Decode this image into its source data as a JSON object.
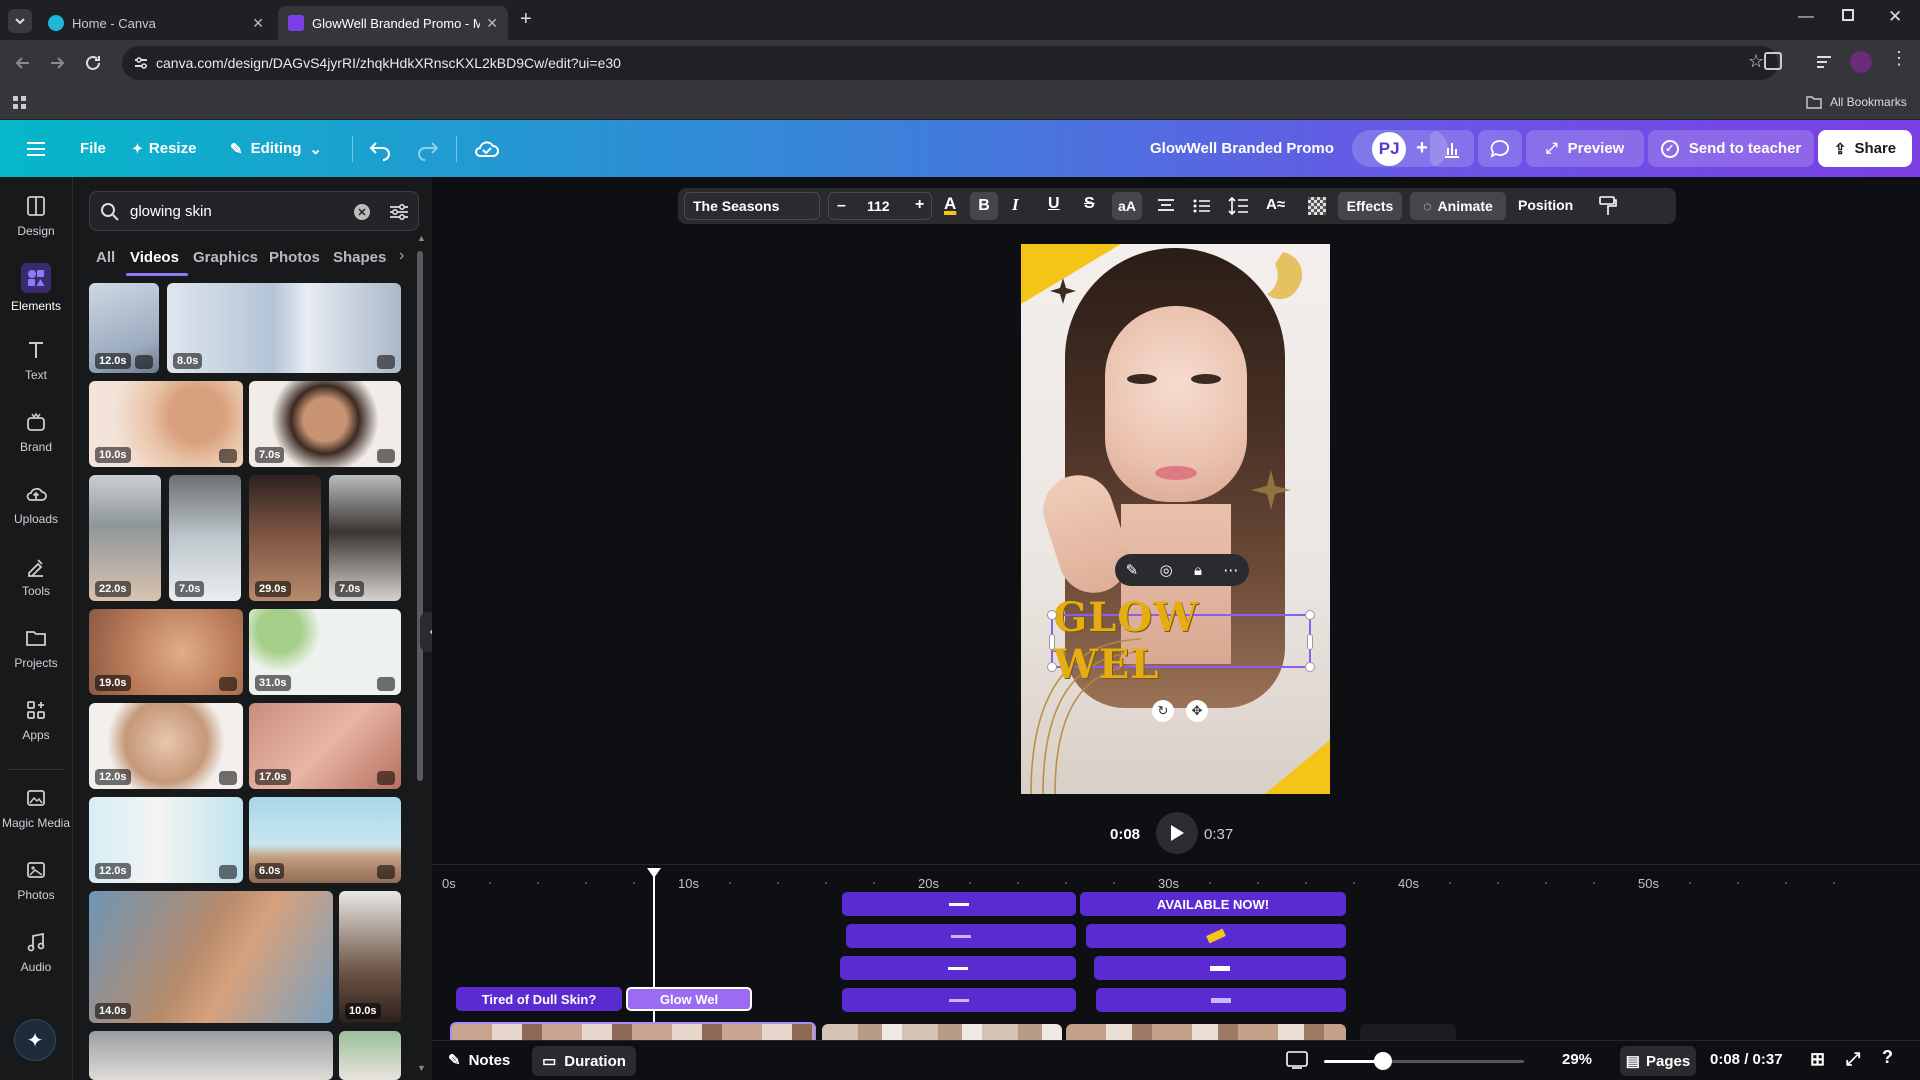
{
  "browser": {
    "tabs": [
      {
        "title": "Home - Canva"
      },
      {
        "title": "GlowWell Branded Promo - Mo"
      }
    ],
    "url": "canva.com/design/DAGvS4jyrRI/zhqkHdkXRnscKXL2kBD9Cw/edit?ui=e30",
    "bookmarks_label": "All Bookmarks"
  },
  "toolbar": {
    "file": "File",
    "resize": "Resize",
    "editing": "Editing",
    "design_title": "GlowWell Branded Promo",
    "avatar": "PJ",
    "preview": "Preview",
    "send_to_teacher": "Send to teacher",
    "share": "Share"
  },
  "rail": [
    {
      "label": "Design",
      "icon": "design-icon"
    },
    {
      "label": "Elements",
      "icon": "elements-icon"
    },
    {
      "label": "Text",
      "icon": "text-icon"
    },
    {
      "label": "Brand",
      "icon": "brand-icon"
    },
    {
      "label": "Uploads",
      "icon": "uploads-icon"
    },
    {
      "label": "Tools",
      "icon": "tools-icon"
    },
    {
      "label": "Projects",
      "icon": "projects-icon"
    },
    {
      "label": "Apps",
      "icon": "apps-icon"
    },
    {
      "label": "Magic Media",
      "icon": "magic-media-icon"
    },
    {
      "label": "Photos",
      "icon": "photos-icon"
    },
    {
      "label": "Audio",
      "icon": "audio-icon"
    }
  ],
  "panel": {
    "search_value": "glowing skin",
    "filters": [
      "All",
      "Videos",
      "Graphics",
      "Photos",
      "Shapes"
    ],
    "active_filter": "Videos",
    "durations": [
      "12.0s",
      "8.0s",
      "10.0s",
      "7.0s",
      "22.0s",
      "7.0s",
      "29.0s",
      "7.0s",
      "19.0s",
      "31.0s",
      "12.0s",
      "17.0s",
      "12.0s",
      "6.0s",
      "14.0s",
      "10.0s"
    ]
  },
  "text_toolbar": {
    "font": "The Seasons",
    "size": "112",
    "effects": "Effects",
    "animate": "Animate",
    "position": "Position"
  },
  "canvas": {
    "headline": "GLOW WEL"
  },
  "playback": {
    "current": "0:08",
    "total": "0:37"
  },
  "timeline": {
    "ruler": [
      "0s",
      "10s",
      "20s",
      "30s",
      "40s",
      "50s"
    ],
    "clip1": "Tired of Dull Skin?",
    "clip2": "Glow Wel",
    "available": "AVAILABLE NOW!"
  },
  "bottom": {
    "notes": "Notes",
    "duration": "Duration",
    "zoom": "29%",
    "pages": "Pages",
    "time": "0:08 / 0:37"
  },
  "colors": {
    "accent": "#7b3fe4",
    "track": "#5a2bd1",
    "yellow": "#f4c518"
  }
}
